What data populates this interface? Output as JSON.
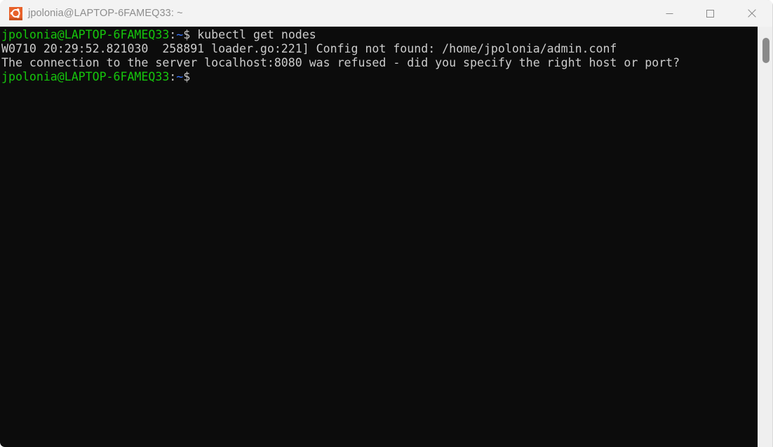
{
  "window": {
    "title": "jpolonia@LAPTOP-6FAMEQ33: ~",
    "app_icon": "ubuntu-icon",
    "titlebar_bg": "#f3f3f3",
    "title_color": "#8d8d8d",
    "controls": {
      "minimize_label": "Minimize",
      "maximize_label": "Maximize",
      "close_label": "Close"
    }
  },
  "terminal": {
    "background": "#0c0c0c",
    "foreground": "#cccccc",
    "prompt_color": "#16c60c",
    "path_color": "#3b78ff",
    "lines": [
      {
        "id": "line-command",
        "segments": [
          {
            "text": "jpolonia@LAPTOP-6FAMEQ33",
            "color": "green"
          },
          {
            "text": ":",
            "color": "white"
          },
          {
            "text": "~",
            "color": "blue"
          },
          {
            "text": "$ kubectl get nodes",
            "color": "white"
          }
        ]
      },
      {
        "id": "line-warning",
        "segments": [
          {
            "text": "W0710 20:29:52.821030  258891 loader.go:221] Config not found: /home/jpolonia/admin.conf",
            "color": "white"
          }
        ]
      },
      {
        "id": "line-error",
        "segments": [
          {
            "text": "The connection to the server localhost:8080 was refused - did you specify the right host or port?",
            "color": "white"
          }
        ]
      },
      {
        "id": "line-prompt",
        "segments": [
          {
            "text": "jpolonia@LAPTOP-6FAMEQ33",
            "color": "green"
          },
          {
            "text": ":",
            "color": "white"
          },
          {
            "text": "~",
            "color": "blue"
          },
          {
            "text": "$",
            "color": "white"
          }
        ]
      }
    ]
  },
  "scrollbar": {
    "track_color": "#efefef",
    "thumb_color": "#8a8a8a"
  }
}
